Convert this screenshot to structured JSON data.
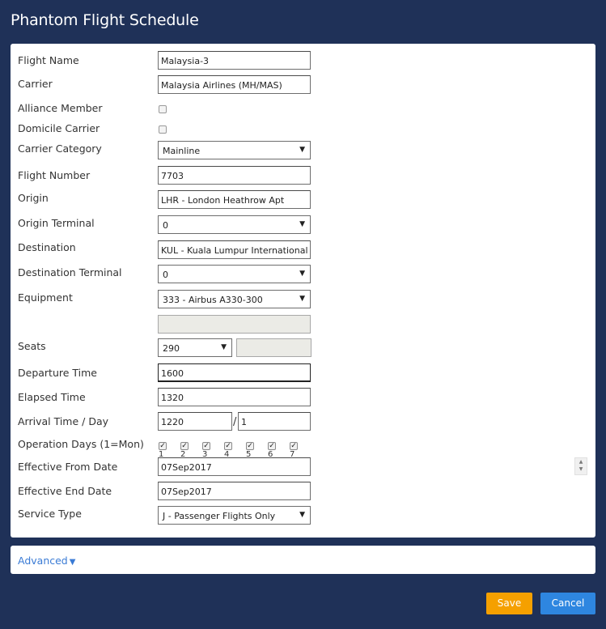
{
  "page": {
    "title": "Phantom Flight Schedule"
  },
  "form": {
    "flight_name": {
      "label": "Flight Name",
      "value": "Malaysia-3"
    },
    "carrier": {
      "label": "Carrier",
      "value": "Malaysia Airlines (MH/MAS)"
    },
    "alliance_member": {
      "label": "Alliance Member",
      "checked": false
    },
    "domicile_carrier": {
      "label": "Domicile Carrier",
      "checked": false
    },
    "carrier_category": {
      "label": "Carrier Category",
      "value": "Mainline"
    },
    "flight_number": {
      "label": "Flight Number",
      "value": "7703"
    },
    "origin": {
      "label": "Origin",
      "value": "LHR - London Heathrow Apt"
    },
    "origin_terminal": {
      "label": "Origin Terminal",
      "value": "0"
    },
    "destination": {
      "label": "Destination",
      "value": "KUL - Kuala Lumpur International Apt"
    },
    "destination_terminal": {
      "label": "Destination Terminal",
      "value": "0"
    },
    "equipment": {
      "label": "Equipment",
      "value": "333 - Airbus A330-300",
      "extra_value": ""
    },
    "seats": {
      "label": "Seats",
      "value": "290",
      "extra_value": ""
    },
    "departure_time": {
      "label": "Departure Time",
      "value": "1600"
    },
    "elapsed_time": {
      "label": "Elapsed Time",
      "value": "1320"
    },
    "arrival_time_day": {
      "label": "Arrival Time / Day",
      "time": "1220",
      "separator": "/",
      "day": "1"
    },
    "operation_days": {
      "label": "Operation Days (1=Mon)",
      "days": [
        {
          "label": "1",
          "checked": true
        },
        {
          "label": "2",
          "checked": true
        },
        {
          "label": "3",
          "checked": true
        },
        {
          "label": "4",
          "checked": true
        },
        {
          "label": "5",
          "checked": true
        },
        {
          "label": "6",
          "checked": true
        },
        {
          "label": "7",
          "checked": true
        }
      ]
    },
    "effective_from_date": {
      "label": "Effective From Date",
      "value": "07Sep2017"
    },
    "effective_end_date": {
      "label": "Effective End Date",
      "value": "07Sep2017"
    },
    "service_type": {
      "label": "Service Type",
      "value": "J - Passenger Flights Only"
    }
  },
  "advanced": {
    "label": "Advanced",
    "icon": "caret-down-icon"
  },
  "buttons": {
    "save": "Save",
    "cancel": "Cancel"
  },
  "colors": {
    "background": "#1f3158",
    "save_button": "#f5a000",
    "cancel_button": "#2e86e0",
    "link": "#3a7bd5"
  }
}
